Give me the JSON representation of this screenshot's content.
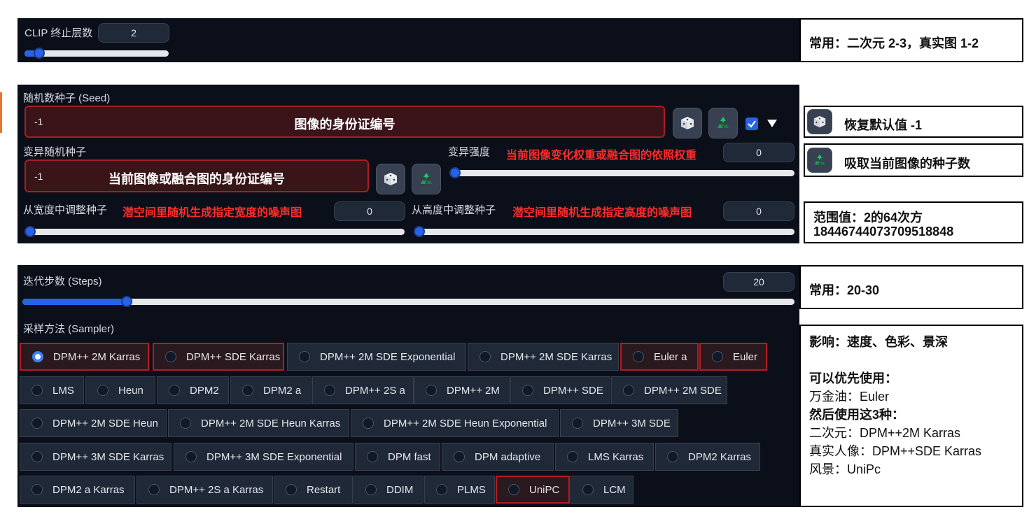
{
  "clip": {
    "label": "CLIP 终止层数",
    "value": "2",
    "slider_fraction": 0.1,
    "note": "常用：二次元 2-3，真实图 1-2"
  },
  "seed": {
    "label": "随机数种子 (Seed)",
    "value": "-1",
    "hint": "图像的身份证编号",
    "extra_checked": true,
    "notes": {
      "dice": "恢复默认值 -1",
      "recycle": "吸取当前图像的种子数",
      "range_line1": "范围值：2的64次方",
      "range_line2": "18446744073709518848"
    }
  },
  "variation": {
    "label": "变异随机种子",
    "value": "-1",
    "hint": "当前图像或融合图的身份证编号",
    "strength_label": "变异强度",
    "strength_hint": "当前图像变化权重或融合图的依照权重",
    "strength_value": "0",
    "strength_fraction": 0
  },
  "resize": {
    "width_label": "从宽度中调整种子",
    "width_hint": "潜空间里随机生成指定宽度的噪声图",
    "width_value": "0",
    "height_label": "从高度中调整种子",
    "height_hint": "潜空间里随机生成指定高度的噪声图",
    "height_value": "0"
  },
  "steps": {
    "label": "迭代步数 (Steps)",
    "value": "20",
    "slider_fraction": 0.135,
    "note": "常用：20-30"
  },
  "sampler": {
    "label": "采样方法 (Sampler)",
    "selected": "DPM++ 2M Karras",
    "options": [
      "DPM++ 2M Karras",
      "DPM++ SDE Karras",
      "DPM++ 2M SDE Exponential",
      "DPM++ 2M SDE Karras",
      "Euler a",
      "Euler",
      "LMS",
      "Heun",
      "DPM2",
      "DPM2 a",
      "DPM++ 2S a",
      "DPM++ 2M",
      "DPM++ SDE",
      "DPM++ 2M SDE",
      "DPM++ 2M SDE Heun",
      "DPM++ 2M SDE Heun Karras",
      "DPM++ 2M SDE Heun Exponential",
      "DPM++ 3M SDE",
      "DPM++ 3M SDE Karras",
      "DPM++ 3M SDE Exponential",
      "DPM fast",
      "DPM adaptive",
      "LMS Karras",
      "DPM2 Karras",
      "DPM2 a Karras",
      "DPM++ 2S a Karras",
      "Restart",
      "DDIM",
      "PLMS",
      "UniPC",
      "LCM"
    ],
    "highlighted": [
      "DPM++ 2M Karras",
      "DPM++ SDE Karras",
      "Euler a",
      "Euler",
      "UniPC"
    ]
  },
  "sampler_note": {
    "line1": "影响：速度、色彩、景深",
    "line2": "可以优先使用：",
    "line3": "万金油：Euler",
    "line4": "然后使用这3种：",
    "line5": "二次元：DPM++2M Karras",
    "line6": "真实人像：DPM++SDE  Karras",
    "line7": "风景：UniPc"
  },
  "colors": {
    "panel": "#0b0f19",
    "accent": "#2563eb",
    "highlight_border": "#b31c22",
    "annotation_red": "#ff2b2b"
  },
  "icons": {
    "dice": "dice-icon",
    "recycle": "recycle-icon",
    "checkbox": "checkbox-icon",
    "dropdown": "triangle-down-icon"
  }
}
